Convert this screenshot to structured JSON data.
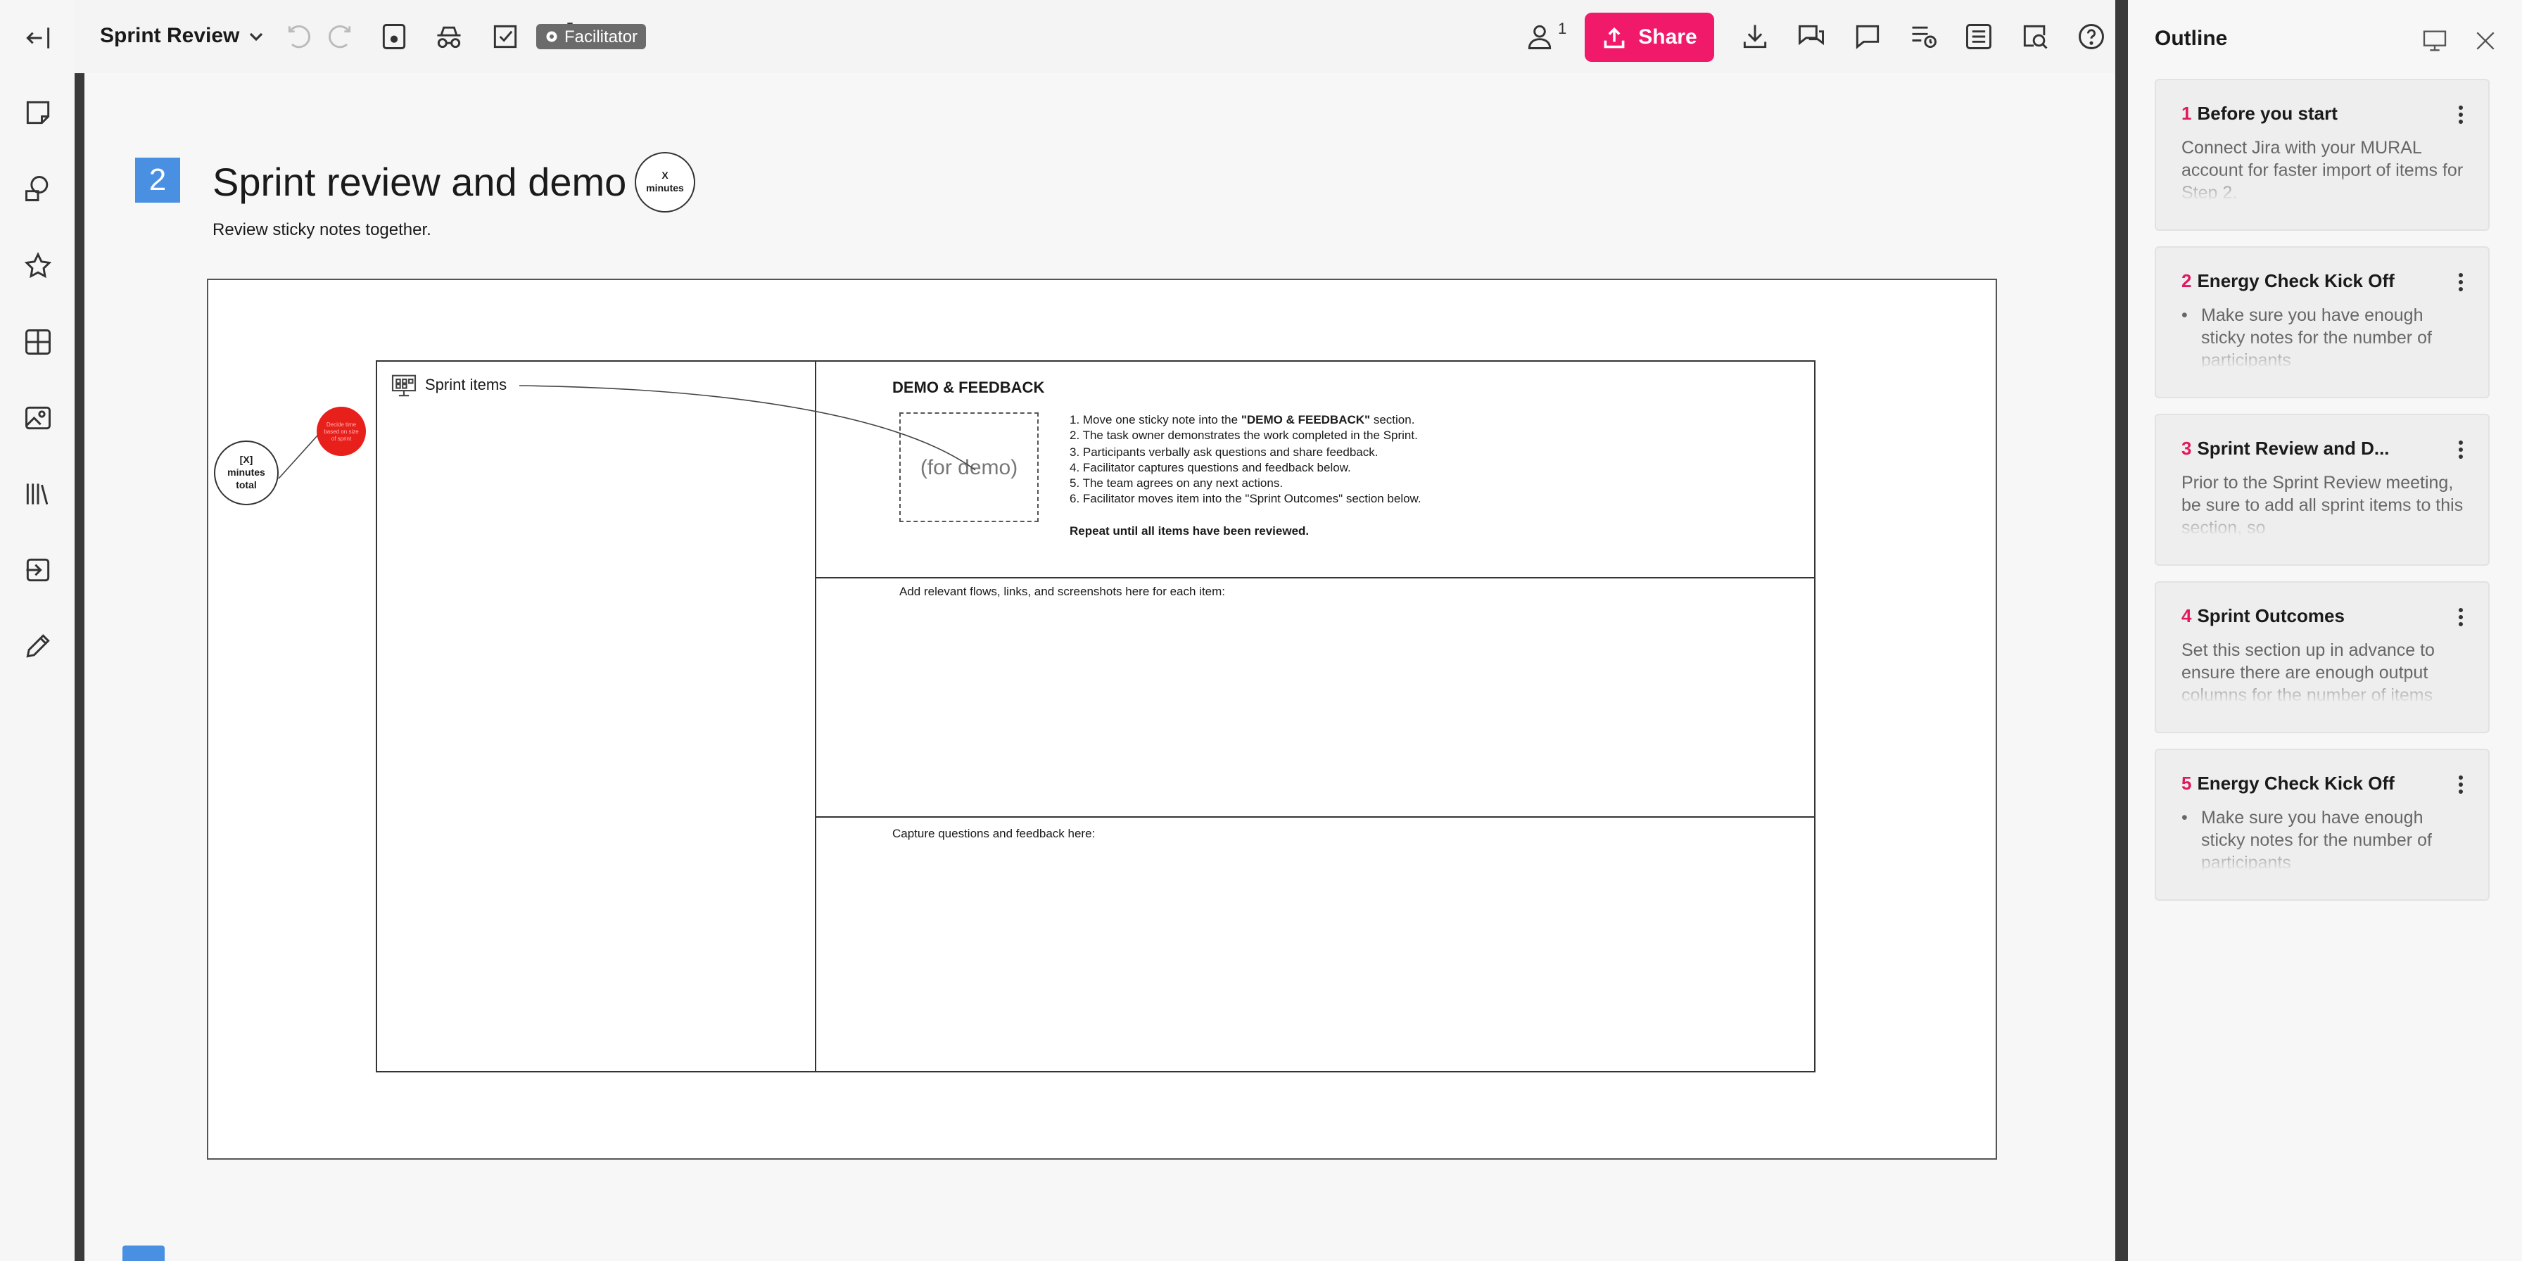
{
  "topbar": {
    "board_title": "Sprint Review",
    "facilitator_label": "Facilitator",
    "share_label": "Share",
    "user_count": "1"
  },
  "board": {
    "step_number": "2",
    "step_title": "Sprint review and demo",
    "time_badge": "X\nminutes",
    "subtitle": "Review sticky notes together.",
    "minutes_total": "[X]\nminutes\ntotal",
    "red_note": "Decide time based on size of sprint",
    "sprint_items_label": "Sprint items",
    "demo_title": "DEMO & FEEDBACK",
    "demo_placeholder": "(for demo)",
    "instructions": [
      "1.  Move one sticky note into the \"DEMO & FEEDBACK\" section.",
      "2. The task owner demonstrates the work completed in the Sprint.",
      "3. Participants verbally ask questions and share feedback.",
      "4. Facilitator captures questions and feedback below.",
      "5. The team agrees on any next actions.",
      "6. Facilitator moves item into the \"Sprint Outcomes\" section below."
    ],
    "repeat_note": "Repeat until all items have been reviewed.",
    "flows_label": "Add relevant flows, links, and screenshots here for each item:",
    "capture_label": "Capture questions and feedback here:"
  },
  "outline": {
    "title": "Outline",
    "cards": [
      {
        "num": "1",
        "title": "Before you start",
        "body": "Connect Jira with your MURAL account for faster import of items for Step 2.",
        "bullet": false
      },
      {
        "num": "2",
        "title": "Energy Check Kick Off",
        "body": "Make sure you have enough sticky notes for the number of participants",
        "bullet": true
      },
      {
        "num": "3",
        "title": "Sprint Review and D...",
        "body": "Prior to the Sprint Review meeting, be sure to add all sprint items to this section, so",
        "bullet": false
      },
      {
        "num": "4",
        "title": "Sprint Outcomes",
        "body": "Set this section up in advance to ensure there are enough output columns for the number of items",
        "bullet": false
      },
      {
        "num": "5",
        "title": "Energy Check Kick Off",
        "body": "Make sure you have enough sticky notes for the number of participants",
        "bullet": true
      }
    ]
  },
  "colors": {
    "accent": "#f0196a",
    "step_blue": "#4a90e2",
    "outline_number": "#e0195f",
    "red_note": "#e8201c"
  }
}
